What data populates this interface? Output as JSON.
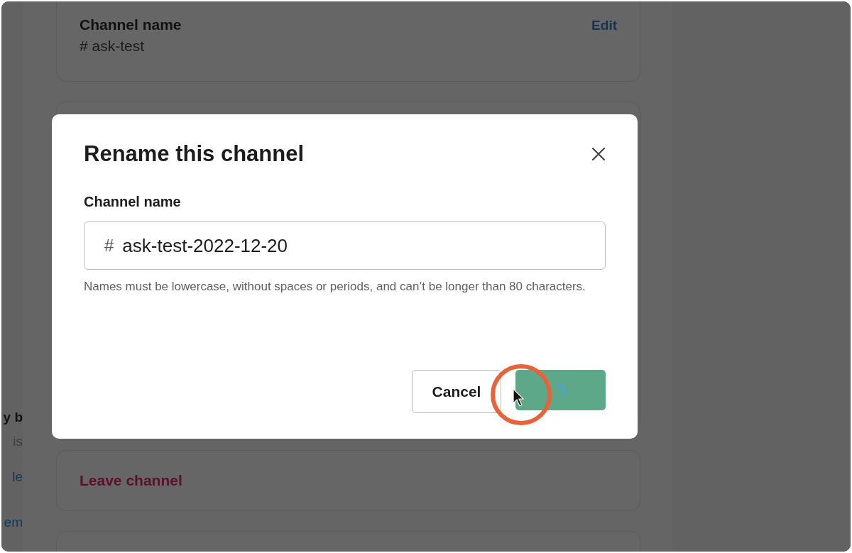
{
  "background": {
    "channel_name_card": {
      "label": "Channel name",
      "value": "# ask-test",
      "edit_link": "Edit"
    },
    "left_fragments": [
      {
        "kind": "heading",
        "text": "y b"
      },
      {
        "kind": "muted",
        "text": "is"
      },
      {
        "kind": "link",
        "text": "le"
      },
      {
        "kind": "link",
        "text": "em"
      }
    ],
    "leave_channel": "Leave channel"
  },
  "dialog": {
    "title": "Rename this channel",
    "field_label": "Channel name",
    "prefix": "#",
    "value": "ask-test-2022-12-20",
    "hint": "Names must be lowercase, without spaces or periods, and can’t be longer than 80 characters.",
    "cancel": "Cancel",
    "submit_loading": true
  }
}
